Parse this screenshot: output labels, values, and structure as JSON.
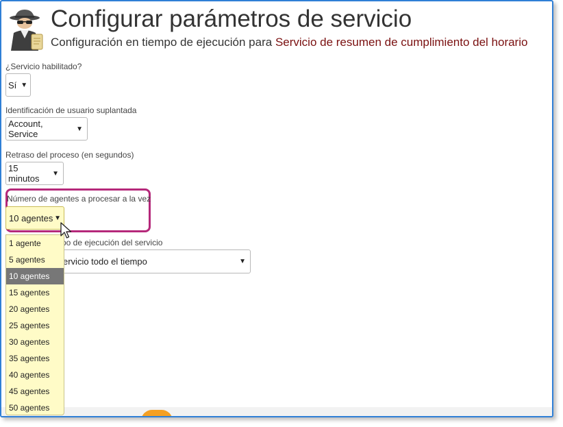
{
  "header": {
    "title": "Configurar parámetros de servicio",
    "subtitle_prefix": "Configuración en tiempo de ejecución para ",
    "service_name": "Servicio de resumen de cumplimiento del horario"
  },
  "fields": {
    "enabled": {
      "label": "¿Servicio habilitado?",
      "value": "Sí"
    },
    "impersonation": {
      "label": "Identificación de usuario suplantada",
      "value": "Account, Service"
    },
    "delay": {
      "label": "Retraso del proceso (en segundos)",
      "value": "15 minutos"
    },
    "agents": {
      "label": "Número de agentes a procesar a la vez",
      "value": "10 agentes"
    },
    "runtime": {
      "label_visible": "po de ejecución del servicio",
      "value_visible": "ervicio todo el tiempo"
    }
  },
  "dropdown": {
    "options": [
      "1 agente",
      "5 agentes",
      "10 agentes",
      "15 agentes",
      "20 agentes",
      "25 agentes",
      "30 agentes",
      "35 agentes",
      "40 agentes",
      "45 agentes",
      "50 agentes"
    ],
    "selected": "10 agentes"
  },
  "colors": {
    "frame": "#2f7fd6",
    "service_name": "#7a1010",
    "highlight": "#b5287a",
    "dropdown_bg": "#fffbc7",
    "selected_bg": "#777777",
    "footer_badge": "#f5a023"
  },
  "icons": {
    "logo": "spy-agent-icon",
    "dropdown_arrow": "chevron-down-icon",
    "pointer": "mouse-cursor-icon"
  }
}
